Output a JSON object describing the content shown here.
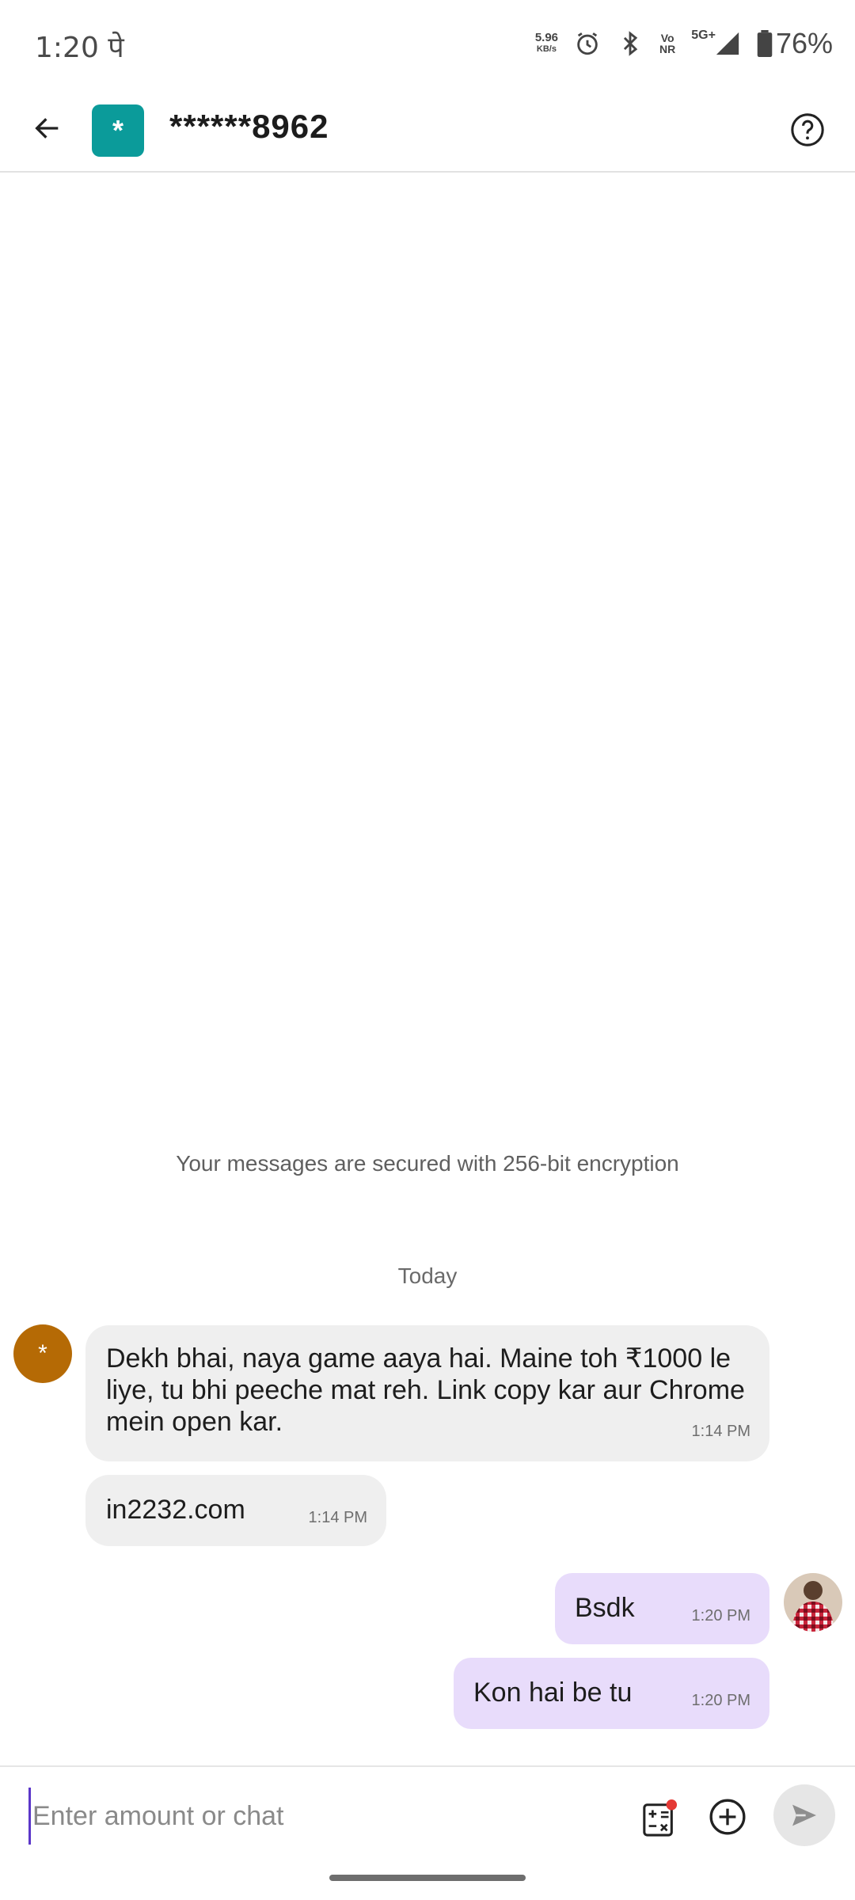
{
  "status_bar": {
    "time": "1:20 पे",
    "net_speed_value": "5.96",
    "net_speed_unit": "KB/s",
    "volte_label_top": "Vo",
    "volte_label_bottom": "NR",
    "network": "5G+",
    "battery": "76%",
    "icons": [
      "alarm-icon",
      "bluetooth-icon",
      "signal-icon",
      "battery-icon"
    ]
  },
  "header": {
    "avatar_char": "*",
    "title": "******8962",
    "avatar_color": "#0b9b9a"
  },
  "chat": {
    "encryption_note": "Your messages are secured with 256-bit encryption",
    "date_separator": "Today",
    "incoming_avatar_char": "*",
    "incoming_avatar_color": "#b56a05",
    "messages": [
      {
        "direction": "in",
        "text": "Dekh bhai, naya game aaya hai. Maine toh ₹1000 le liye, tu bhi peeche mat reh. Link copy kar aur Chrome mein open kar.",
        "time": "1:14 PM"
      },
      {
        "direction": "in",
        "text": "in2232.com",
        "time": "1:14 PM"
      },
      {
        "direction": "out",
        "text": "Bsdk",
        "time": "1:20 PM"
      },
      {
        "direction": "out",
        "text": "Kon hai be tu",
        "time": "1:20 PM"
      }
    ]
  },
  "input_bar": {
    "placeholder": "Enter amount or chat",
    "accent_color": "#5b36c9"
  }
}
